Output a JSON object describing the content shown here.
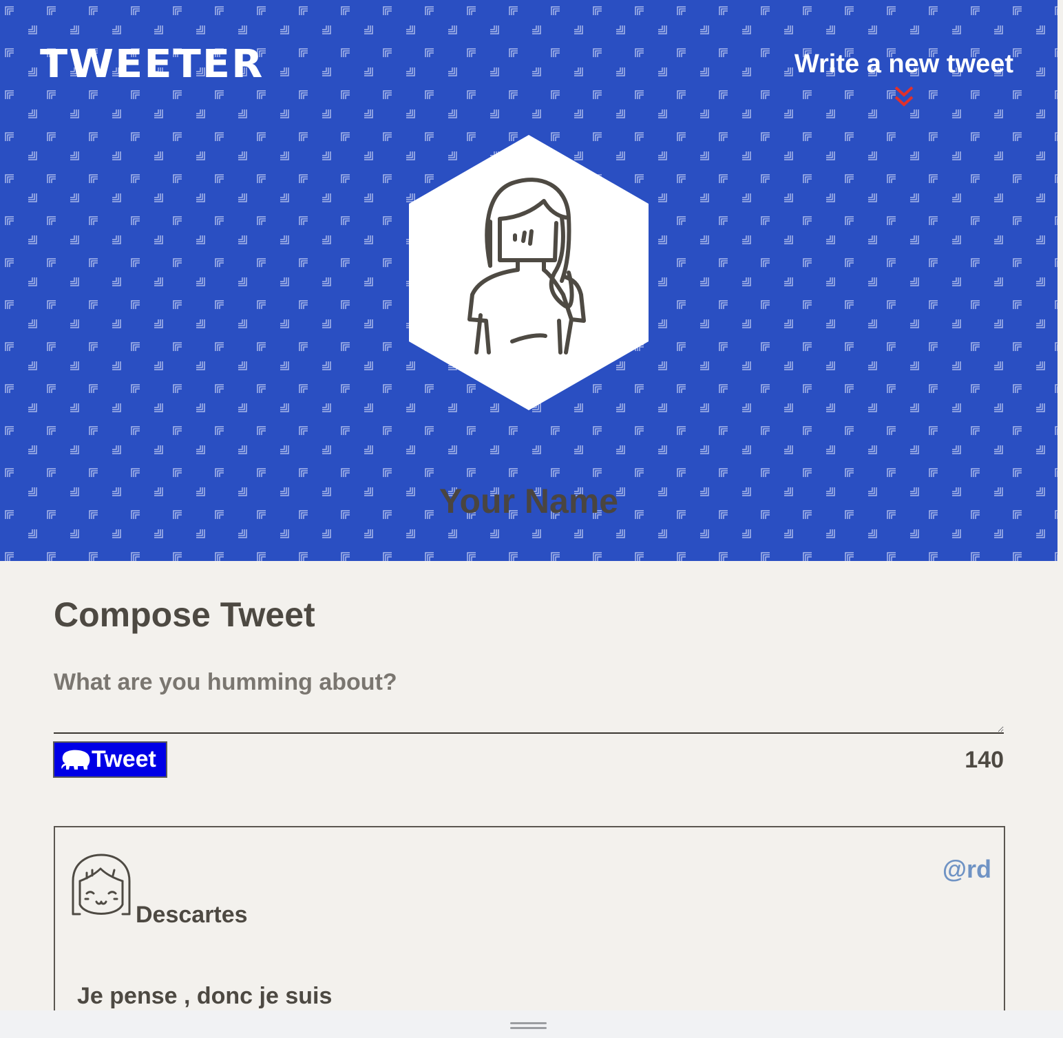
{
  "header": {
    "logo_text": "TWEETER",
    "write_link_label": "Write a new tweet",
    "write_link_icon": "double-chevron-down-icon",
    "profile_name": "Your Name",
    "profile_avatar_icon": "woman-avatar-icon"
  },
  "compose": {
    "title": "Compose Tweet",
    "placeholder": "What are you humming about?",
    "value": "",
    "button_label": "Tweet",
    "button_icon": "elephant-icon",
    "char_counter": "140"
  },
  "tweets": [
    {
      "author_name": "Descartes",
      "handle": "@rd",
      "text": "Je pense , donc je suis",
      "avatar_icon": "girl-avatar-icon"
    }
  ],
  "colors": {
    "hero_background": "#2a4fc2",
    "page_background": "#f3f1ed",
    "tweet_button": "#0000e6",
    "handle": "#6f93c4",
    "accent_arrows": "#e0312d",
    "text": "#4d4942"
  }
}
